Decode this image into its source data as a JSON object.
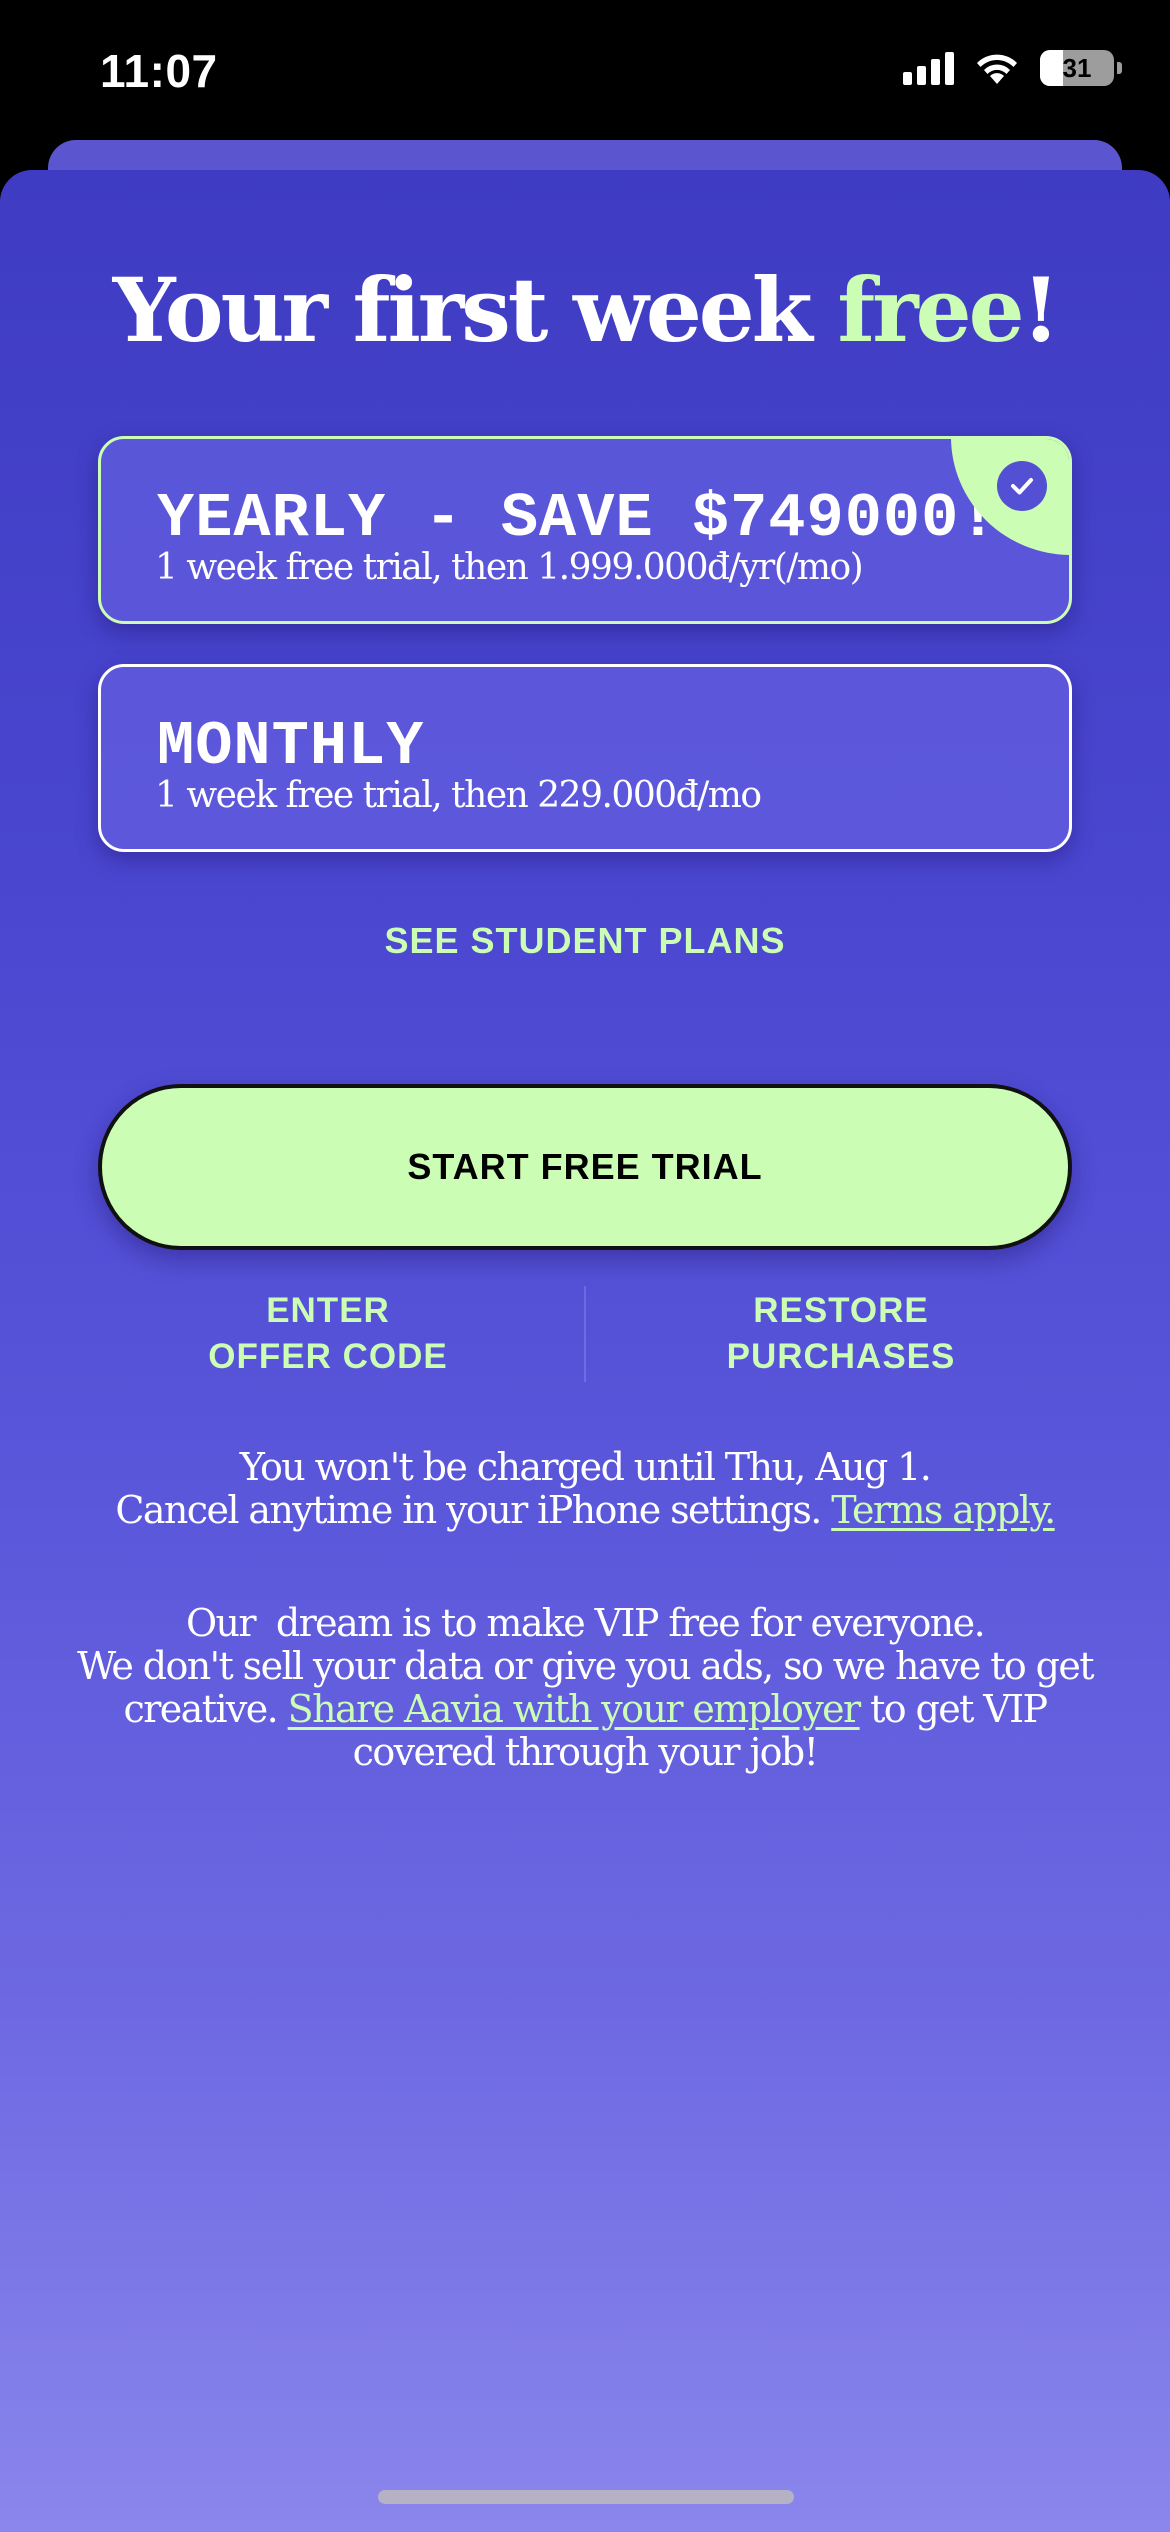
{
  "status_bar": {
    "time": "11:07",
    "battery": "31",
    "battery_level": 0.31,
    "icons": [
      "signal-icon",
      "wifi-icon",
      "battery-icon"
    ]
  },
  "colors": {
    "accent": "#ccfdb4",
    "sheet_top": "#3f3cc3",
    "sheet_bottom": "#8a86ec",
    "cta_text": "#000000"
  },
  "headline": {
    "prefix": "Your first week ",
    "accent": "free",
    "suffix": "!"
  },
  "plans": [
    {
      "title": "YEARLY - SAVE $749000!",
      "subtitle": "1 week free trial, then 1.999.000đ/yr(/mo)",
      "selected": true
    },
    {
      "title": "MONTHLY",
      "subtitle": "1 week free trial, then 229.000đ/mo",
      "selected": false
    }
  ],
  "student_plans_label": "SEE STUDENT PLANS",
  "cta": {
    "label": "START FREE TRIAL"
  },
  "secondary_actions": {
    "offer_code_line1": "ENTER",
    "offer_code_line2": "OFFER CODE",
    "restore_line1": "RESTORE",
    "restore_line2": "PURCHASES"
  },
  "charge_note": {
    "line1": "You won't be charged until Thu, Aug 1.",
    "line2": "Cancel anytime in your iPhone settings.",
    "terms_link": "Terms apply."
  },
  "mission_note": {
    "line1": "Our  dream is to make VIP free for everyone.",
    "line2": "We don't sell your data or give you ads, so we have to get",
    "line3_prefix": "creative.",
    "share_link": "Share Aavia with your employer",
    "line3_suffix": "to get VIP",
    "line4": "covered through your job!"
  }
}
